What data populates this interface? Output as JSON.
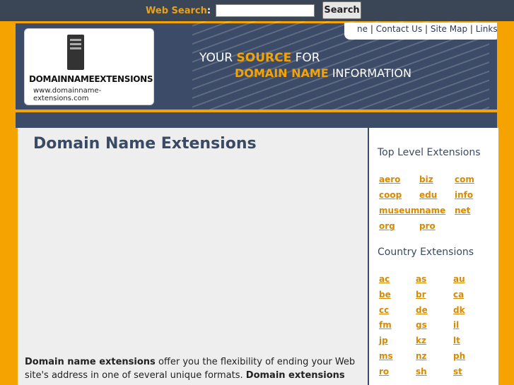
{
  "search": {
    "label": "Web Search",
    "colon": ":",
    "placeholder": "",
    "button": "Search"
  },
  "toplinks": [
    "ne",
    "Contact Us",
    "Site Map",
    "Links"
  ],
  "logo": {
    "main": "DOMAINNAMEEXTENSIONS",
    "url": "www.domainname-extensions.com"
  },
  "tagline": {
    "line1_a": "YOUR",
    "line1_b": "SOURCE",
    "line1_c": "FOR",
    "line2_a": "DOMAIN NAME",
    "line2_b": "INFORMATION"
  },
  "main": {
    "title": "Domain Name Extensions",
    "para_b1": "Domain name extensions",
    "para_t1": " offer you the flexibility of ending your Web site's address in one of several unique formats. ",
    "para_b2": "Domain extensions"
  },
  "sidebar": {
    "tld_title": "Top Level Extensions",
    "tlds": [
      "aero",
      "biz",
      "com",
      "coop",
      "edu",
      "info",
      "museum",
      "name",
      "net",
      "org",
      "pro"
    ],
    "cc_title": "Country Extensions",
    "ccs": [
      "ac",
      "as",
      "au",
      "be",
      "br",
      "ca",
      "cc",
      "de",
      "dk",
      "fm",
      "gs",
      "il",
      "jp",
      "kz",
      "lt",
      "ms",
      "nz",
      "ph",
      "ro",
      "sh",
      "st"
    ]
  },
  "colors": {
    "accent": "#f5a300",
    "navy": "#3c4b67",
    "link": "#d88a00"
  }
}
